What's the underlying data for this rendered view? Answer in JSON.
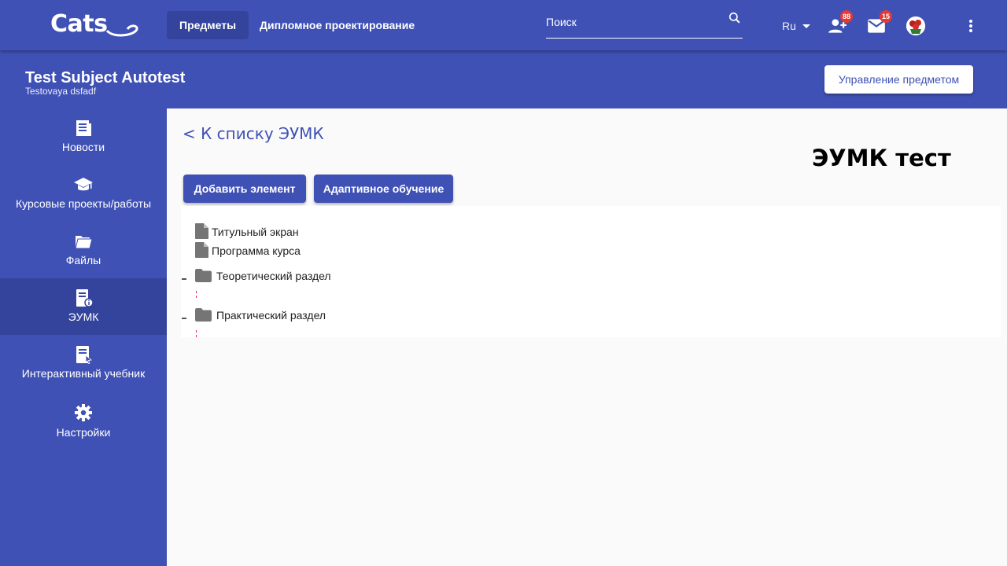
{
  "header": {
    "logo_text": "Cats",
    "nav": [
      {
        "label": "Предметы",
        "active": true
      },
      {
        "label": "Дипломное проектирование",
        "active": false
      }
    ],
    "search_placeholder": "Поиск",
    "language": "Ru",
    "friend_requests_count": "88",
    "messages_count": "15",
    "icons": [
      "search-icon",
      "person-add-icon",
      "mail-icon",
      "more-vert-icon"
    ]
  },
  "subject": {
    "title": "Test Subject Autotest",
    "subtitle": "Testovaya dsfadf",
    "manage_button": "Управление предметом"
  },
  "sidebar": {
    "items": [
      {
        "label": "Новости",
        "icon": "news-icon",
        "active": false
      },
      {
        "label": "Курсовые проекты/работы",
        "icon": "graduation-cap-icon",
        "active": false
      },
      {
        "label": "Файлы",
        "icon": "folder-icon",
        "active": false
      },
      {
        "label": "ЭУМК",
        "icon": "book-info-icon",
        "active": true
      },
      {
        "label": "Интерактивный учебник",
        "icon": "interactive-book-icon",
        "active": false
      },
      {
        "label": "Настройки",
        "icon": "gear-icon",
        "active": false
      }
    ]
  },
  "main": {
    "back_link": "< К списку ЭУМК",
    "title": "ЭУМК тест",
    "add_button": "Добавить элемент",
    "adaptive_button": "Адаптивное обучение",
    "tree": [
      {
        "label": "Титульный экран",
        "type": "file"
      },
      {
        "label": "Программа курса",
        "type": "file"
      },
      {
        "label": "Теоретический раздел",
        "type": "folder"
      },
      {
        "label": "Практический раздел",
        "type": "folder"
      }
    ]
  },
  "colors": {
    "primary": "#3f51b5",
    "primary_dark": "#34449c",
    "badge": "#e53935",
    "tree_icon": "#757575",
    "content_bg": "#fafafa"
  }
}
